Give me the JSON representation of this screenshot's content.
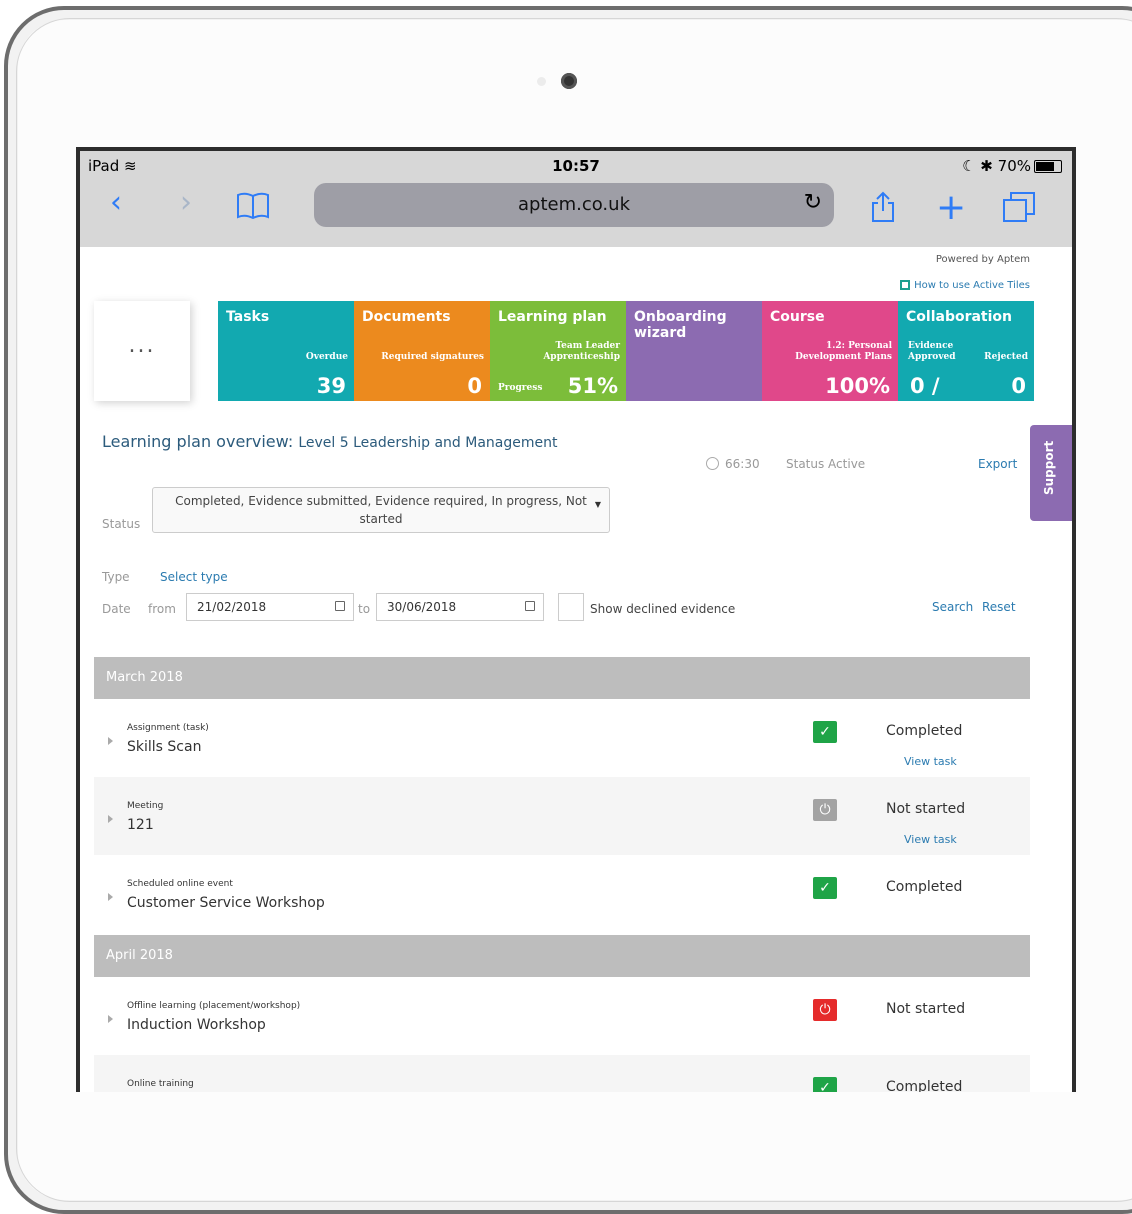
{
  "status_bar": {
    "device": "iPad",
    "time": "10:57",
    "battery": "70%"
  },
  "browser": {
    "url": "aptem.co.uk"
  },
  "header": {
    "powered_by": "Powered by Aptem",
    "how_to": "How to use Active Tiles"
  },
  "more_tile": "...",
  "tiles": [
    {
      "title": "Tasks",
      "sub": "Overdue",
      "value": "39",
      "color": "#12a9b0"
    },
    {
      "title": "Documents",
      "sub": "Required signatures",
      "value": "0",
      "color": "#ec8a1e"
    },
    {
      "title": "Learning plan",
      "sub": "Team Leader Apprenticeship",
      "label": "Progress",
      "value": "51%",
      "color": "#7cbd3a"
    },
    {
      "title": "Onboarding wizard",
      "color": "#8c6bb1"
    },
    {
      "title": "Course",
      "sub": "1.2: Personal Development Plans",
      "value": "100%",
      "color": "#e0488a"
    },
    {
      "title": "Collaboration",
      "sub_left": "Evidence Approved",
      "sub_right": "Rejected",
      "value_left": "0 /",
      "value": "0",
      "color": "#12a9b0"
    }
  ],
  "overview": {
    "title": "Learning plan overview:",
    "subtitle": "Level 5 Leadership and Management",
    "time": "66:30",
    "status": "Status Active",
    "export": "Export",
    "support": "Support"
  },
  "filters": {
    "status_label": "Status",
    "status_value": "Completed, Evidence submitted, Evidence required, In progress, Not started",
    "type_label": "Type",
    "type_value": "Select type",
    "date_label": "Date",
    "from_label": "from",
    "from_value": "21/02/2018",
    "to_label": "to",
    "to_value": "30/06/2018",
    "declined_label": "Show declined evidence",
    "search": "Search",
    "reset": "Reset"
  },
  "months": [
    {
      "name": "March 2018",
      "rows": [
        {
          "type": "Assignment (task)",
          "name": "Skills Scan",
          "icon": "check-icon",
          "status": "Completed",
          "link": "View task"
        },
        {
          "type": "Meeting",
          "name": "121",
          "icon": "power-icon",
          "status": "Not started",
          "link": "View task"
        },
        {
          "type": "Scheduled online event",
          "name": "Customer Service Workshop",
          "icon": "check-icon",
          "status": "Completed"
        }
      ]
    },
    {
      "name": "April 2018",
      "rows": [
        {
          "type": "Offline learning (placement/workshop)",
          "name": "Induction Workshop",
          "icon": "power-icon",
          "status": "Not started"
        },
        {
          "type": "Online training",
          "name": "",
          "icon": "check-icon",
          "status": "Completed"
        }
      ]
    }
  ]
}
